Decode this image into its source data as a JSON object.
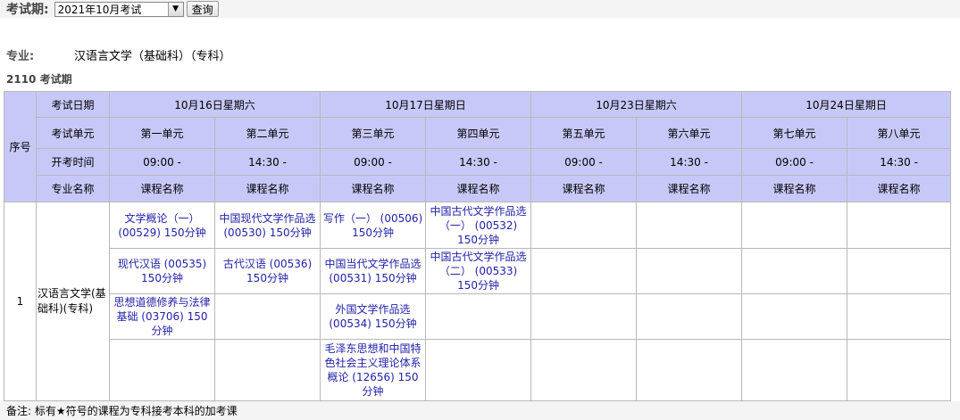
{
  "header": {
    "label": "考试期:",
    "selected": "2021年10月考试",
    "query_button": "查询"
  },
  "major": {
    "label": "专业:",
    "value": "汉语言文学（基础科）（专科）"
  },
  "period_label": "2110  考试期",
  "table": {
    "seq_header": "序号",
    "row_labels": [
      "考试日期",
      "考试单元",
      "开考时间",
      "专业名称"
    ],
    "dates": [
      "10月16日星期六",
      "10月17日星期日",
      "10月23日星期六",
      "10月24日星期日"
    ],
    "units": [
      "第一单元",
      "第二单元",
      "第三单元",
      "第四单元",
      "第五单元",
      "第六单元",
      "第七单元",
      "第八单元"
    ],
    "times": [
      "09:00 -",
      "14:30 -",
      "09:00 -",
      "14:30 -",
      "09:00 -",
      "14:30 -",
      "09:00 -",
      "14:30 -"
    ],
    "course_header": "课程名称",
    "seq": "1",
    "major_name": "汉语言文学(基础科)(专科)",
    "rows": [
      [
        "文学概论（一）(00529) 150分钟",
        "中国现代文学作品选(00530) 150分钟",
        "写作（一） (00506) 150分钟",
        "中国古代文学作品选（一） (00532) 150分钟",
        "",
        "",
        "",
        ""
      ],
      [
        "现代汉语 (00535) 150分钟",
        "古代汉语 (00536) 150分钟",
        "中国当代文学作品选(00531) 150分钟",
        "中国古代文学作品选（二） (00533) 150分钟",
        "",
        "",
        "",
        ""
      ],
      [
        "思想道德修养与法律基础 (03706) 150分钟",
        "",
        "外国文学作品选(00534) 150分钟",
        "",
        "",
        "",
        "",
        ""
      ],
      [
        "",
        "",
        "毛泽东思想和中国特色社会主义理论体系概论 (12656) 150分钟",
        "",
        "",
        "",
        "",
        ""
      ]
    ]
  },
  "note": "备注:   标有★符号的课程为专科接考本科的加考课"
}
